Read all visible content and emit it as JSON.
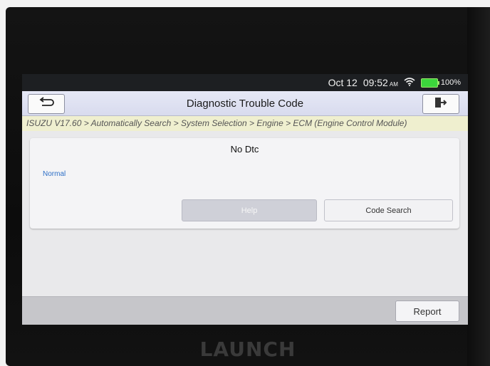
{
  "status_bar": {
    "date": "Oct 12",
    "time": "09:52",
    "ampm": "AM",
    "battery": "100%"
  },
  "header": {
    "title": "Diagnostic Trouble Code"
  },
  "breadcrumb": "ISUZU V17.60 > Automatically Search > System Selection > Engine > ECM (Engine Control Module)",
  "dtc_panel": {
    "title": "No Dtc",
    "status": "Normal",
    "help_label": "Help",
    "code_search_label": "Code Search"
  },
  "footer": {
    "report_label": "Report"
  },
  "device": {
    "brand": "LAUNCH"
  },
  "colors": {
    "status_text": "#2d6fc6",
    "breadcrumb_bg": "#efefcf",
    "battery": "#3cd63c"
  },
  "icons": {
    "back": "back-arrow-icon",
    "exit": "exit-icon",
    "wifi": "wifi-icon",
    "battery": "battery-icon"
  }
}
